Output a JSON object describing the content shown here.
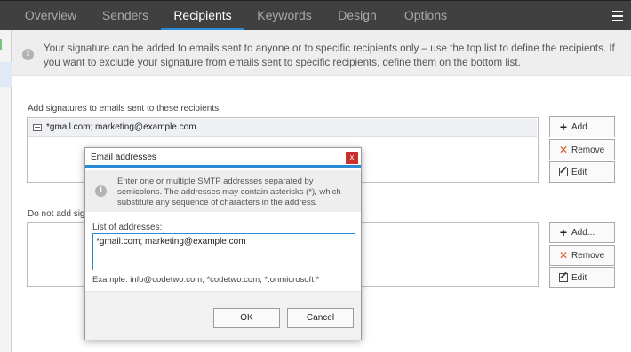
{
  "tabs": [
    {
      "label": "Overview",
      "active": false
    },
    {
      "label": "Senders",
      "active": false
    },
    {
      "label": "Recipients",
      "active": true
    },
    {
      "label": "Keywords",
      "active": false
    },
    {
      "label": "Design",
      "active": false
    },
    {
      "label": "Options",
      "active": false
    }
  ],
  "menu_icon": "hamburger-icon",
  "info": {
    "icon": "info-icon",
    "text": "Your signature can be added to emails sent to anyone or to specific recipients only – use the top list to define the recipients. If you want to exclude your signature from emails sent to specific recipients, define them on the bottom list."
  },
  "include": {
    "label": "Add signatures to emails sent to these recipients:",
    "items": [
      "*gmail.com; marketing@example.com"
    ]
  },
  "exclude": {
    "label": "Do not add signa",
    "items": []
  },
  "buttons": {
    "add": "Add...",
    "remove": "Remove",
    "edit": "Edit"
  },
  "dialog": {
    "title": "Email addresses",
    "close": "x",
    "info_text": "Enter one or multiple SMTP addresses separated by semicolons. The addresses may contain asterisks (*), which substitute any sequence of characters in the address.",
    "field_label": "List of addresses:",
    "field_value": "*gmail.com; marketing@example.com",
    "example": "Example: info@codetwo.com; *codetwo.com; *.onmicrosoft.*",
    "ok": "OK",
    "cancel": "Cancel"
  },
  "colors": {
    "tabbar_bg": "#404040",
    "accent": "#2a8ad4",
    "remove_icon": "#d9531e",
    "close_button": "#c9302c"
  }
}
